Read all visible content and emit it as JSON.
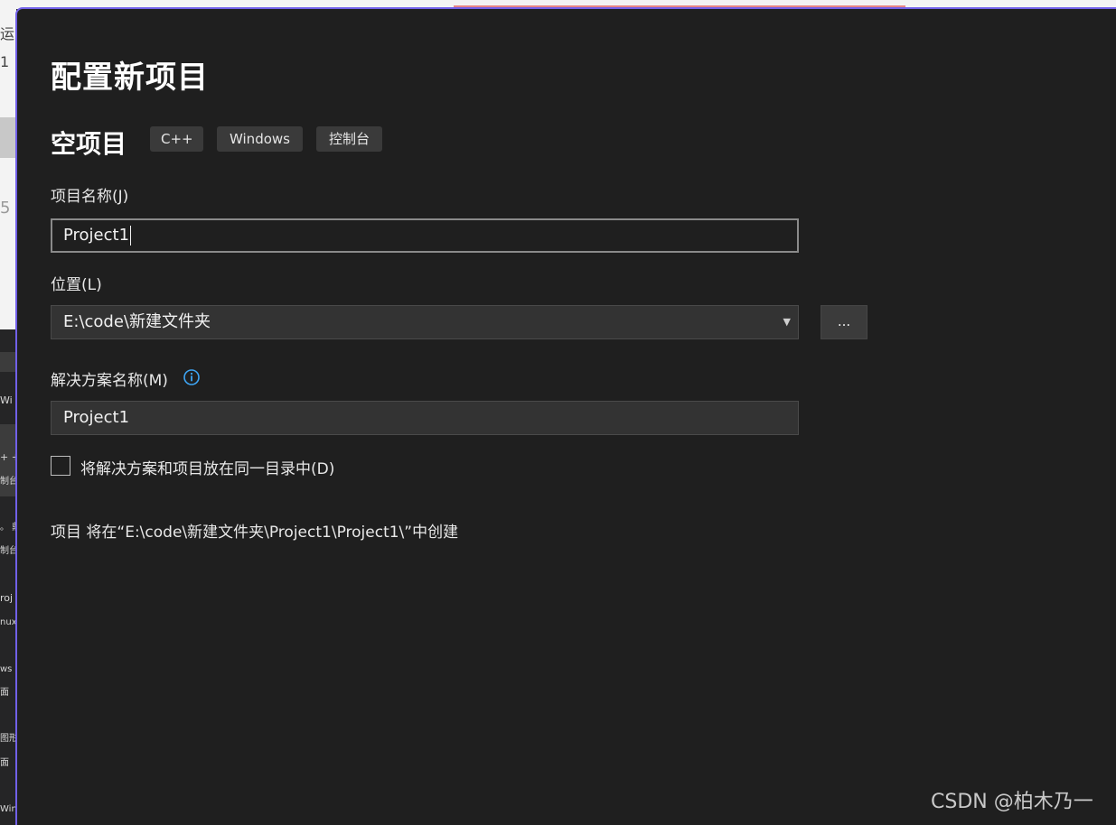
{
  "dialog": {
    "title": "配置新项目",
    "template_name": "空项目",
    "tags": [
      "C++",
      "Windows",
      "控制台"
    ]
  },
  "project_name": {
    "label": "项目名称(J)",
    "value": "Project1"
  },
  "location": {
    "label": "位置(L)",
    "value": "E:\\code\\新建文件夹",
    "browse_label": "..."
  },
  "solution_name": {
    "label": "解决方案名称(M)",
    "value": "Project1",
    "info_icon": "info-icon"
  },
  "same_directory": {
    "label": "将解决方案和项目放在同一目录中(D)",
    "checked": false
  },
  "create_path_text": "项目 将在“E:\\code\\新建文件夹\\Project1\\Project1\\”中创建",
  "watermark": "CSDN @柏木乃一",
  "background_fragments": [
    "运",
    "1",
    "5",
    "Wi",
    "+ +",
    "制台",
    "。 鼎",
    "制台",
    "roj",
    "nux",
    "ws 原",
    "面",
    "图形",
    "面",
    "Win"
  ],
  "colors": {
    "dialog_bg": "#1f1f1f",
    "accent_border": "#7160e8",
    "info_icon": "#3ea6f5"
  }
}
